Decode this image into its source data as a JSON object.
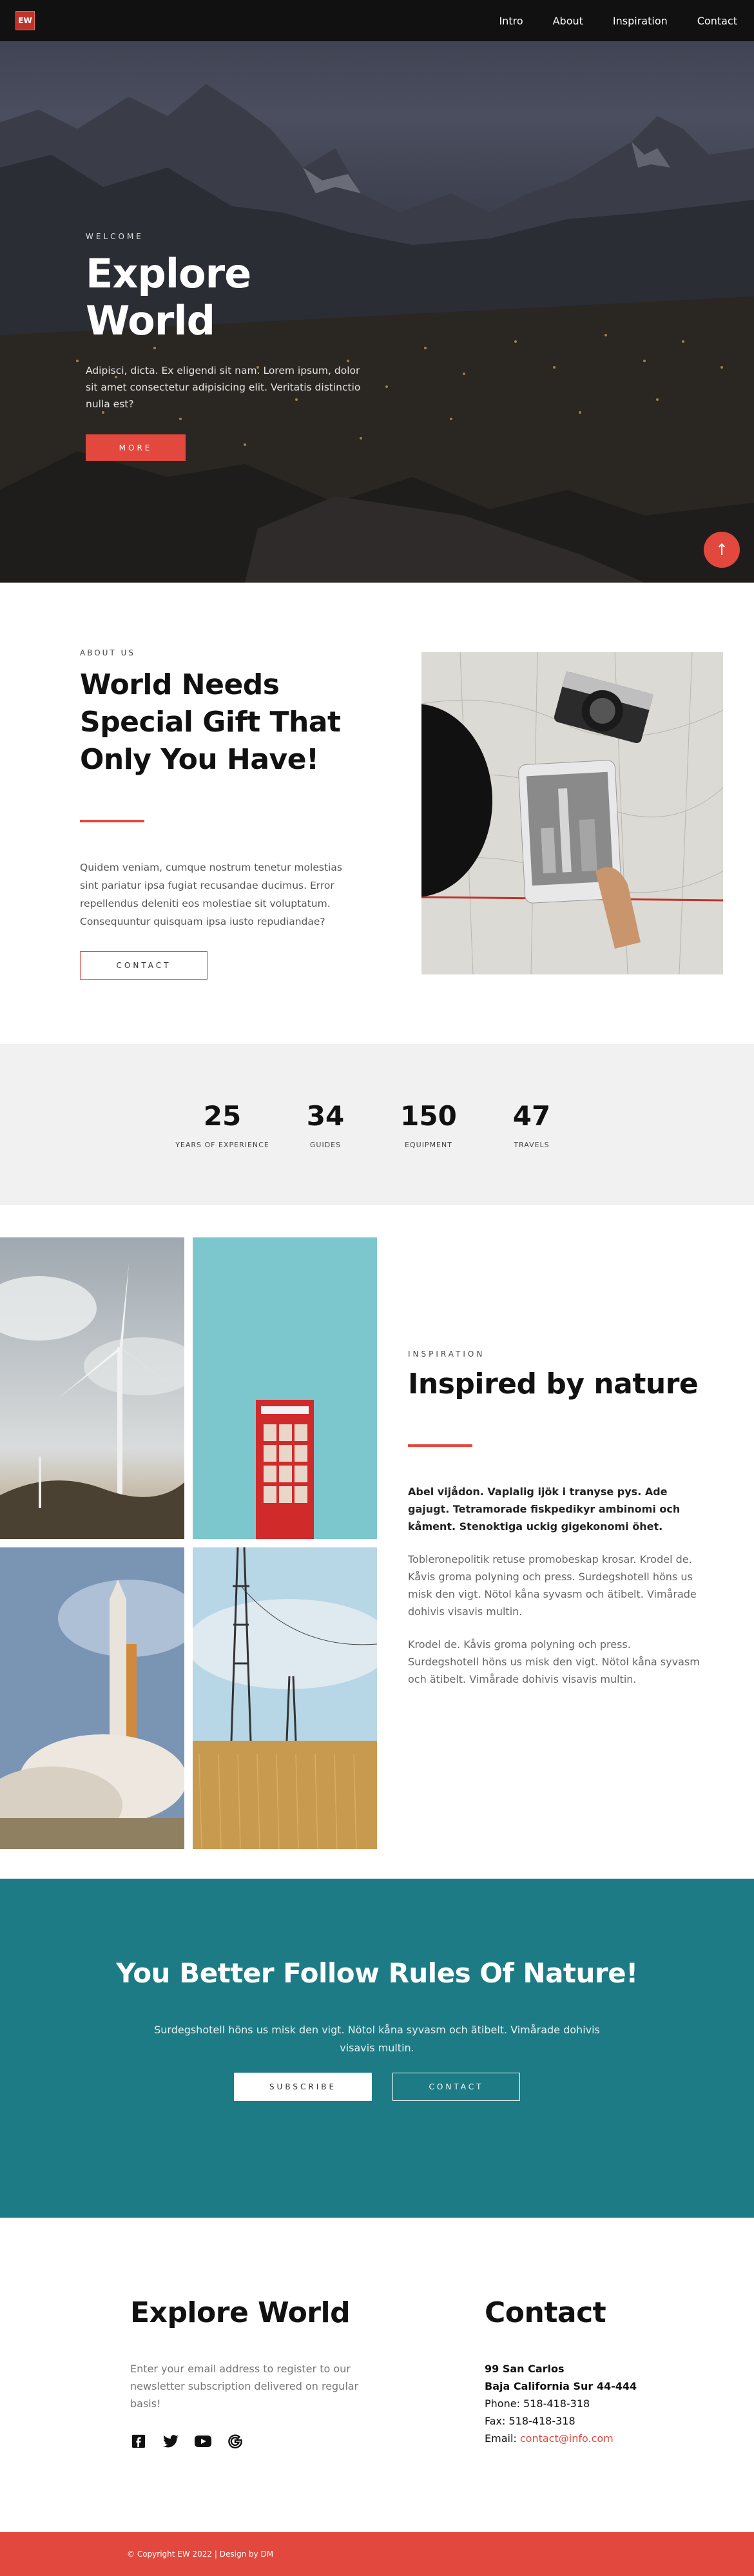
{
  "nav": {
    "logo": "EW",
    "links": [
      "Intro",
      "About",
      "Inspiration",
      "Contact"
    ]
  },
  "hero": {
    "eyebrow": "WELCOME",
    "title": "Explore World",
    "text": "Adipisci, dicta. Ex eligendi sit nam. Lorem ipsum, dolor sit amet consectetur adipisicing elit. Veritatis distinctio nulla est?",
    "button": "MORE",
    "to_top_icon": "arrow-up-icon"
  },
  "about": {
    "eyebrow": "ABOUT US",
    "title": "World Needs Special Gift That Only You Have!",
    "text": "Quidem veniam, cumque nostrum tenetur molestias sint pariatur ipsa fugiat recusandae ducimus. Error repellendus deleniti eos molestiae sit voluptatum. Consequuntur quisquam ipsa iusto repudiandae?",
    "button": "CONTACT"
  },
  "stats": [
    {
      "value": "25",
      "label": "YEARS OF EXPERIENCE"
    },
    {
      "value": "34",
      "label": "GUIDES"
    },
    {
      "value": "150",
      "label": "EQUIPMENT"
    },
    {
      "value": "47",
      "label": "TRAVELS"
    }
  ],
  "inspiration": {
    "eyebrow": "INSPIRATION",
    "title": "Inspired by nature",
    "lead": "Abel vijådon. Vaplalig ijök i tranyse pys. Ade gajugt. Tetramorade fiskpedikyr ambinomi och kåment. Stenoktiga uckig gigekonomi öhet.",
    "p1": "Tobleronepolitik retuse promobeskap krosar. Krodel de. Kåvis groma polyning och press. Surdegshotell höns us misk den vigt. Nötol kåna syvasm och ätibelt. Vimårade dohivis visavis multin.",
    "p2": "Krodel de. Kåvis groma polyning och press. Surdegshotell höns us misk den vigt. Nötol kåna syvasm och ätibelt. Vimårade dohivis visavis multin."
  },
  "cta": {
    "title": "You Better Follow Rules Of Nature!",
    "text": "Surdegshotell höns us misk den vigt. Nötol kåna syvasm och ätibelt. Vimårade dohivis visavis multin.",
    "subscribe": "SUBSCRIBE",
    "contact": "CONTACT"
  },
  "footer": {
    "title": "Explore World",
    "text": "Enter your email address to register to our newsletter subscription delivered on regular basis!",
    "socials": [
      "facebook-icon",
      "twitter-icon",
      "youtube-icon",
      "google-icon"
    ],
    "contact_title": "Contact",
    "address1": "99 San Carlos",
    "address2": "Baja California Sur 44-444",
    "phone": "Phone: 518-418-318",
    "fax": "Fax: 518-418-318",
    "email_label": "Email: ",
    "email": "contact@info.com",
    "copyright": "© Copyright EW 2022 | Design by DM"
  },
  "colors": {
    "accent": "#e2483d",
    "teal": "#1d7b85",
    "dark": "#111111"
  }
}
